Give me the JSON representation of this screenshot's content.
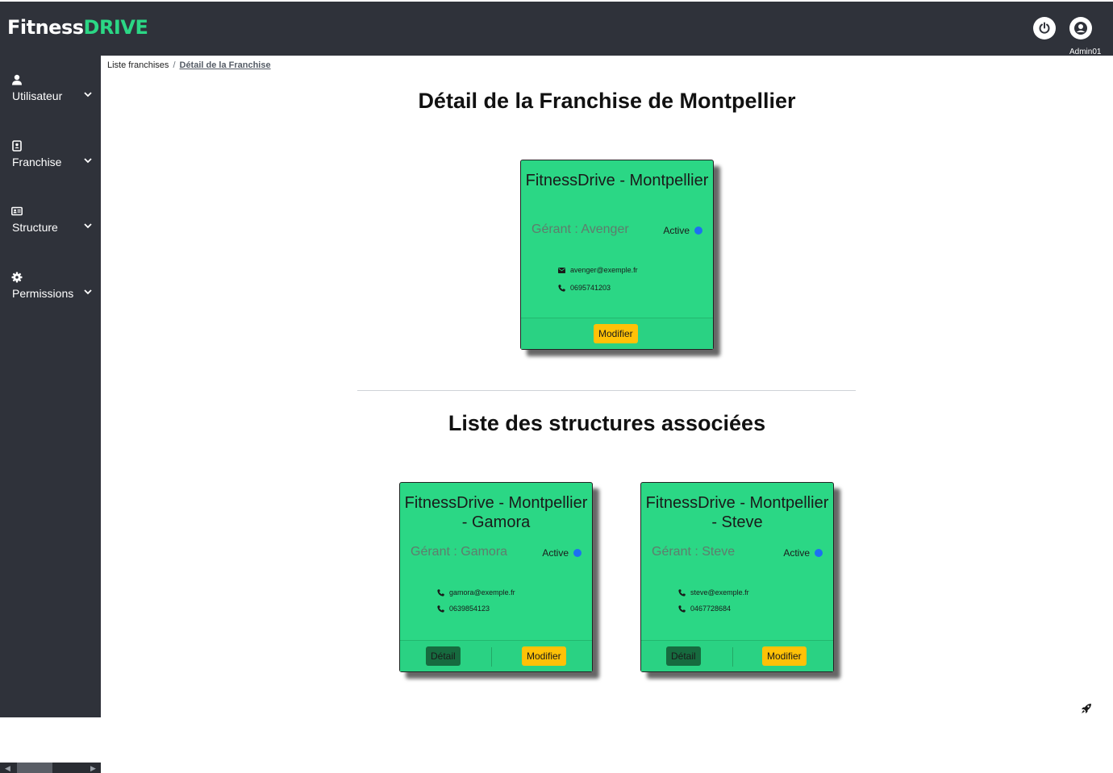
{
  "brand": {
    "part1": "Fitness",
    "part2": "DRIVE"
  },
  "header": {
    "admin_label": "Admin01"
  },
  "sidebar": {
    "items": [
      {
        "label": "Utilisateur",
        "icon": "user-icon"
      },
      {
        "label": "Franchise",
        "icon": "address-book-icon"
      },
      {
        "label": "Structure",
        "icon": "id-card-icon"
      },
      {
        "label": "Permissions",
        "icon": "gear-icon"
      }
    ]
  },
  "breadcrumb": {
    "parent": "Liste franchises",
    "separator": "/",
    "current": "Détail de la Franchise"
  },
  "page_title": "Détail de la Franchise de Montpellier",
  "franchise": {
    "title": "FitnessDrive - Montpellier",
    "manager": "Gérant : Avenger",
    "status": "Active",
    "email": "avenger@exemple.fr",
    "phone": "0695741203",
    "modify_label": "Modifier"
  },
  "structures_title": "Liste des structures associées",
  "structures": [
    {
      "title": "FitnessDrive - Montpellier - Gamora",
      "manager": "Gérant : Gamora",
      "status": "Active",
      "email": "gamora@exemple.fr",
      "phone": "0639854123",
      "detail_label": "Détail",
      "modify_label": "Modifier"
    },
    {
      "title": "FitnessDrive - Montpellier - Steve",
      "manager": "Gérant : Steve",
      "status": "Active",
      "email": "steve@exemple.fr",
      "phone": "0467728684",
      "detail_label": "Détail",
      "modify_label": "Modifier"
    }
  ],
  "colors": {
    "accent": "#2bd785",
    "sidebar": "#2f323a",
    "warning": "#ffc107",
    "status_dot": "#1d6ff2"
  }
}
